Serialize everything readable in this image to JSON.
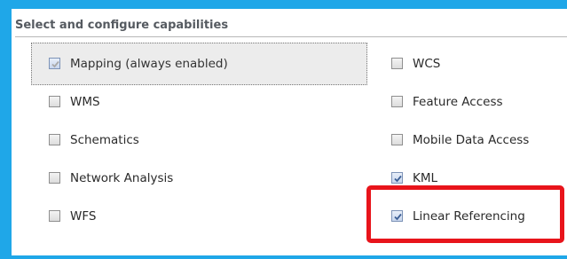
{
  "panel": {
    "title": "Select and configure capabilities"
  },
  "capabilities": {
    "mapping": {
      "label": "Mapping (always enabled)",
      "checked": true,
      "enabled": false
    },
    "wcs": {
      "label": "WCS",
      "checked": false
    },
    "wms": {
      "label": "WMS",
      "checked": false
    },
    "feature_access": {
      "label": "Feature Access",
      "checked": false
    },
    "schematics": {
      "label": "Schematics",
      "checked": false
    },
    "mobile_data_access": {
      "label": "Mobile Data Access",
      "checked": false
    },
    "network_analysis": {
      "label": "Network Analysis",
      "checked": false
    },
    "kml": {
      "label": "KML",
      "checked": true
    },
    "wfs": {
      "label": "WFS",
      "checked": false
    },
    "linear_referencing": {
      "label": "Linear Referencing",
      "checked": true
    }
  },
  "colors": {
    "frame_border": "#1fa7e8",
    "highlight": "#e8141b",
    "check_mark": "#3c5f95"
  }
}
